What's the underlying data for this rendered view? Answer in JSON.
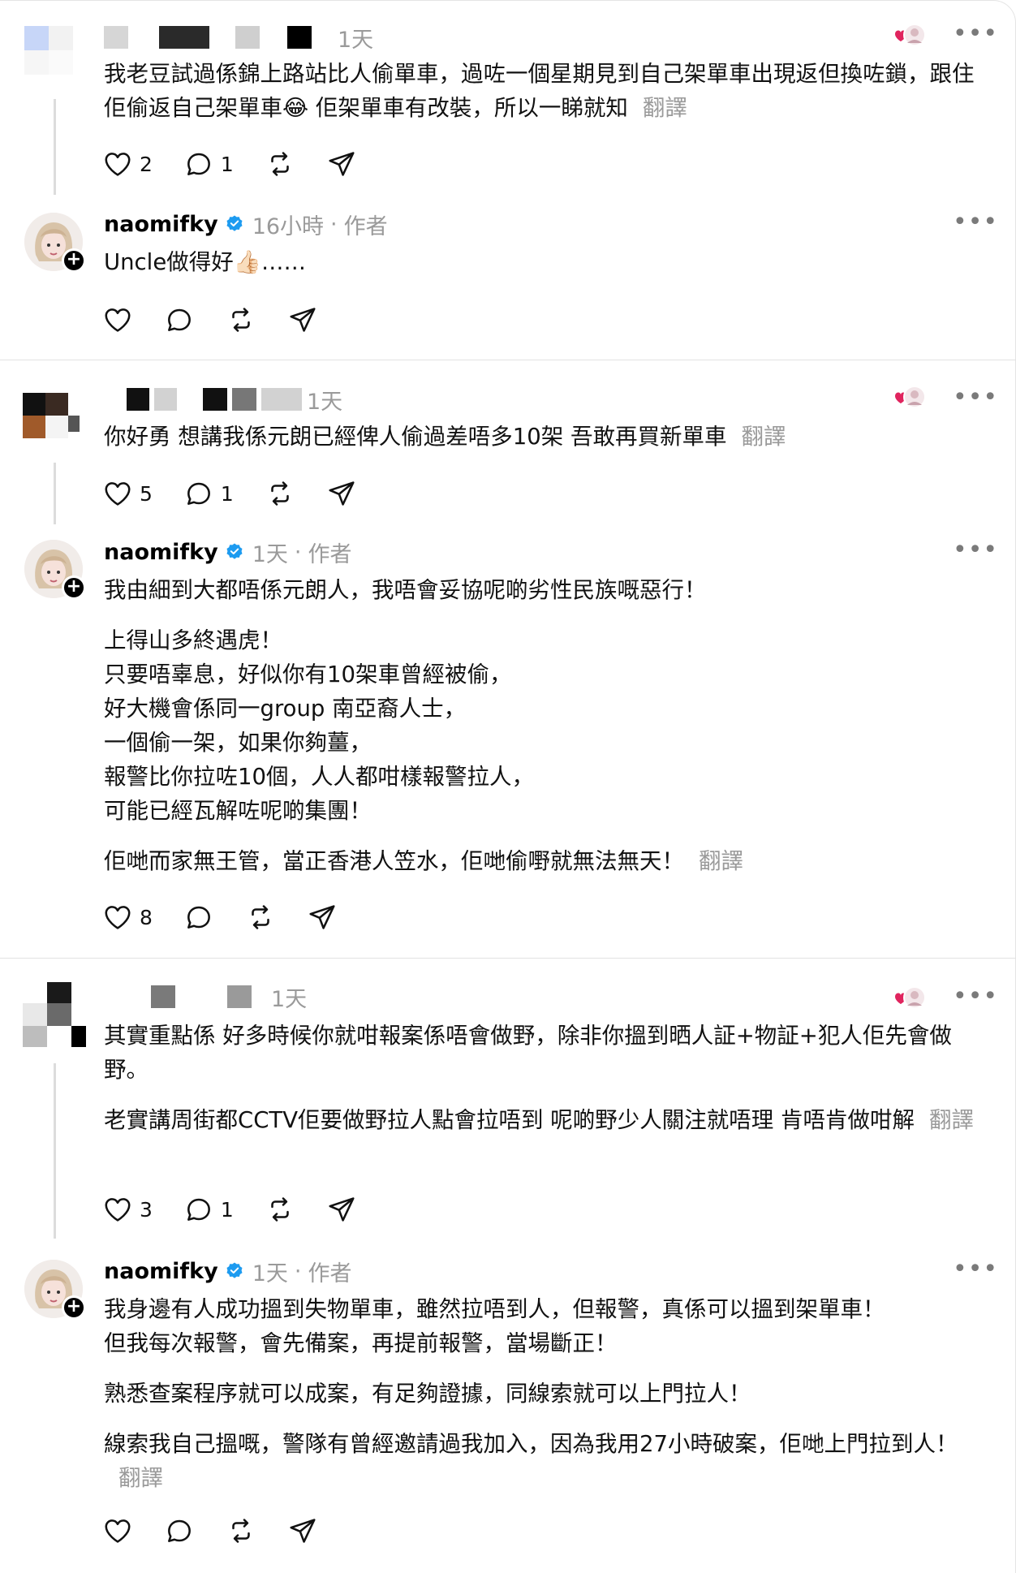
{
  "translate_label": "翻譯",
  "author_label": "作者",
  "separator": "·",
  "posts": [
    {
      "type": "commenter",
      "time": "1天",
      "text": [
        "我老豆試過係錦上路站比人偷單車，過咗一個星期見到自己架單車出現返但換咗鎖，跟住佢偷返自己架單車😂 佢架單車有改裝，所以一睇就知"
      ],
      "likes": "2",
      "replies": "1"
    },
    {
      "type": "author",
      "username": "naomifky",
      "time": "16小時",
      "text": [
        "Uncle做得好👍🏻……"
      ],
      "likes": "",
      "replies": ""
    },
    {
      "type": "commenter",
      "time": "1天",
      "text": [
        "你好勇 想講我係元朗已經俾人偷過差唔多10架 吾敢再買新單車"
      ],
      "likes": "5",
      "replies": "1"
    },
    {
      "type": "author",
      "username": "naomifky",
      "time": "1天",
      "text": [
        "我由細到大都唔係元朗人，我唔會妥協呢啲劣性民族嘅惡行！",
        "上得山多終遇虎！\n只要唔辜息，好似你有10架車曾經被偷，\n好大機會係同一group 南亞裔人士，\n一個偷一架，如果你夠薑，\n報警比你拉咗10個，人人都咁樣報警拉人，\n可能已經瓦解咗呢啲集團！",
        "佢哋而家無王管，當正香港人笠水，佢哋偷嘢就無法無天！"
      ],
      "likes": "8",
      "replies": ""
    },
    {
      "type": "commenter",
      "time": "1天",
      "text": [
        "其實重點係 好多時候你就咁報案係唔會做野，除非你搵到晒人証+物証+犯人佢先會做野。",
        "老實講周街都CCTV佢要做野拉人點會拉唔到 呢啲野少人關注就唔理 肯唔肯做咁解"
      ],
      "likes": "3",
      "replies": "1"
    },
    {
      "type": "author",
      "username": "naomifky",
      "time": "1天",
      "text": [
        "我身邊有人成功搵到失物單車，雖然拉唔到人，但報警，真係可以搵到架單車！\n但我每次報警，會先備案，再提前報警，￼當場斷正！",
        "熟悉查案程序就可以成案，有足夠證據，同線索就可以上門拉人！",
        "線索我自己搵嘅，警隊有曾經邀請過我加入，因為我用27小時破案，佢哋上門拉到人！"
      ],
      "likes": "",
      "replies": ""
    }
  ],
  "colors": {
    "verified": "#1d9bf0",
    "heart": "#e0245e",
    "muted": "#9a9a9a"
  }
}
